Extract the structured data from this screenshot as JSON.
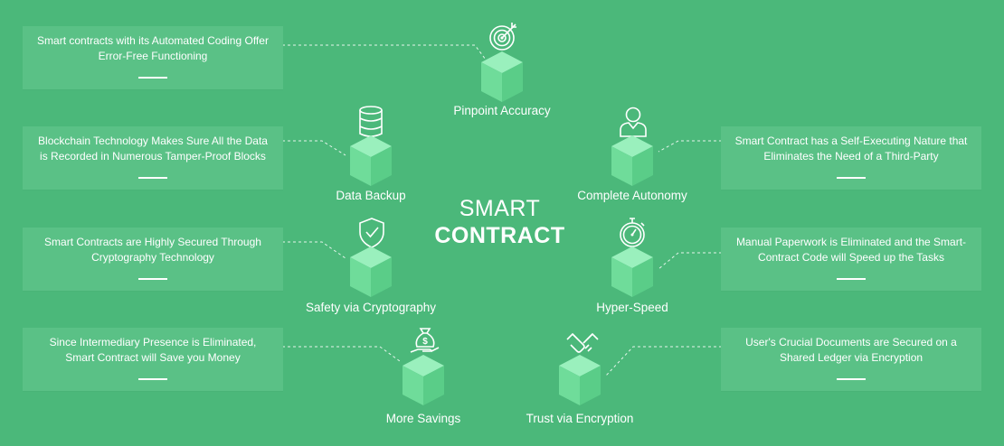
{
  "title": {
    "line1": "SMART",
    "line2": "CONTRACT"
  },
  "nodes": [
    {
      "label": "Pinpoint Accuracy",
      "icon": "target-icon",
      "desc": "Smart contracts with its Automated Coding Offer Error-Free Functioning"
    },
    {
      "label": "Data Backup",
      "icon": "database-icon",
      "desc": "Blockchain Technology Makes Sure All the Data is Recorded in Numerous Tamper-Proof Blocks"
    },
    {
      "label": "Complete Autonomy",
      "icon": "person-icon",
      "desc": "Smart Contract has a Self-Executing Nature that Eliminates the Need of a Third-Party"
    },
    {
      "label": "Safety via Cryptography",
      "icon": "shield-check-icon",
      "desc": "Smart Contracts are Highly Secured Through Cryptography Technology"
    },
    {
      "label": "Hyper-Speed",
      "icon": "stopwatch-icon",
      "desc": "Manual Paperwork is Eliminated and the Smart-Contract Code will Speed up the Tasks"
    },
    {
      "label": "More Savings",
      "icon": "money-bag-hand-icon",
      "desc": "Since Intermediary Presence is Eliminated, Smart Contract will Save you Money"
    },
    {
      "label": "Trust via Encryption",
      "icon": "handshake-icon",
      "desc": "User's Crucial Documents are Secured on a Shared Ledger  via Encryption"
    }
  ],
  "colors": {
    "background": "#4bb87a",
    "card": "#5ac186",
    "text": "#ffffff"
  }
}
